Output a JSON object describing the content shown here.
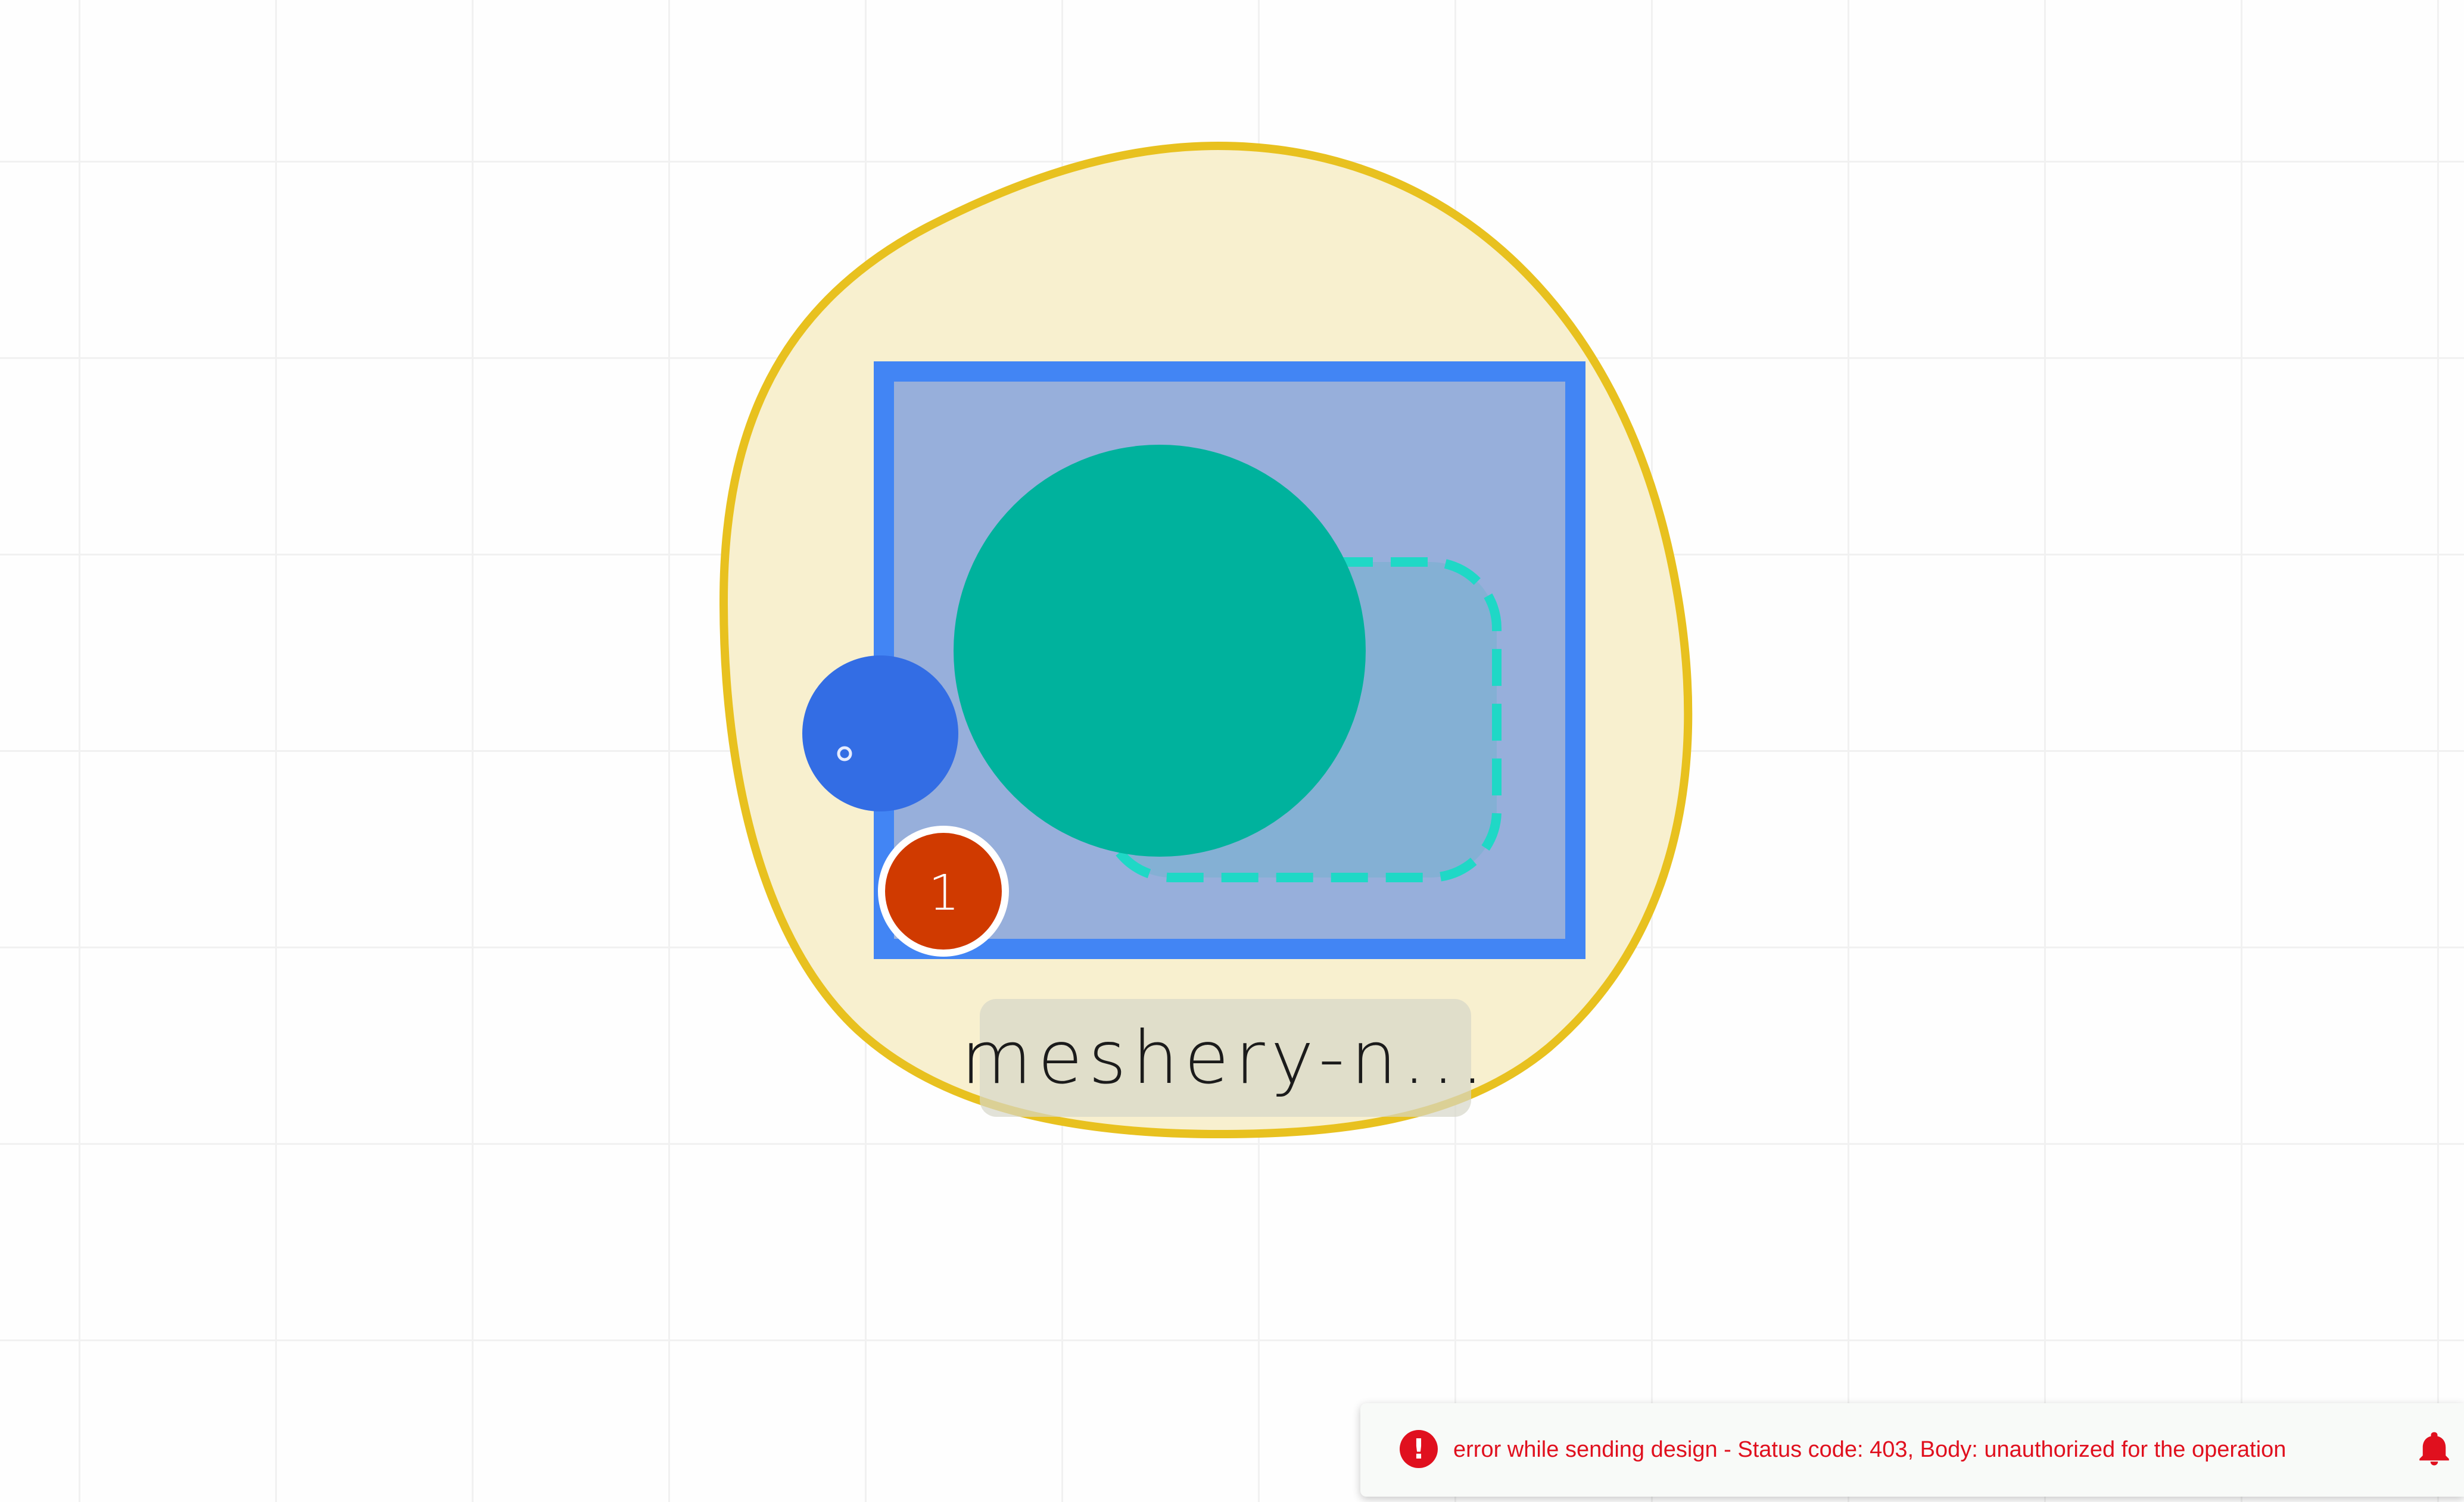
{
  "canvas": {
    "background_color": "#fefefe",
    "grid_line_color": "#f1f1f1"
  },
  "design": {
    "group_fill_color": "#f8f0cf",
    "group_stroke_color": "#e8c11f",
    "node_fill_color": "#97afdb",
    "node_stroke_color": "#4285f4",
    "component_circle_color": "#00b29d",
    "dashed_shape_color": "#1fd8c6",
    "port_color": "#336de4",
    "node_label": "meshery-n...",
    "badge": {
      "count": "1",
      "color": "#d03a00"
    }
  },
  "notification": {
    "icon": "error-icon",
    "icon_glyph": "!",
    "message": "error while sending design - Status code: 403, Body: unauthorized for the operation",
    "color": "#e0101e",
    "bell_icon": "bell-icon"
  }
}
